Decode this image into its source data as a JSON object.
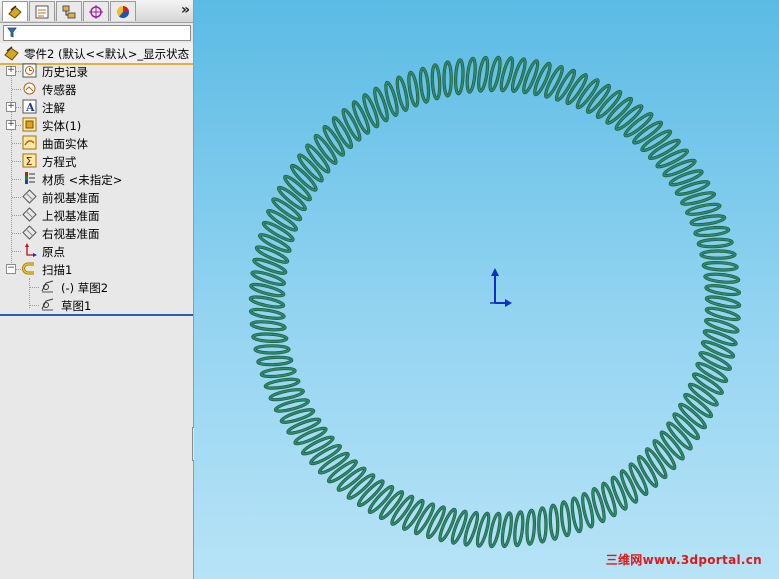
{
  "tabs": [
    {
      "name": "featuremanager",
      "icon": "feature-tree-icon"
    },
    {
      "name": "propertymanager",
      "icon": "property-manager-icon"
    },
    {
      "name": "configurationmanager",
      "icon": "configuration-icon"
    },
    {
      "name": "dimxpert",
      "icon": "dimxpert-icon"
    },
    {
      "name": "display",
      "icon": "display-manager-icon"
    }
  ],
  "more_label": "»",
  "root": {
    "label": "零件2 (默认<<默认>_显示状态"
  },
  "tree": [
    {
      "label": "历史记录",
      "icon": "history-icon",
      "expandable": true
    },
    {
      "label": "传感器",
      "icon": "sensor-icon",
      "expandable": false
    },
    {
      "label": "注解",
      "icon": "annotation-icon",
      "expandable": true
    },
    {
      "label": "实体(1)",
      "icon": "solid-body-icon",
      "expandable": true
    },
    {
      "label": "曲面实体",
      "icon": "surface-body-icon",
      "expandable": false
    },
    {
      "label": "方程式",
      "icon": "equation-icon",
      "expandable": false
    },
    {
      "label": "材质 <未指定>",
      "icon": "material-icon",
      "expandable": false
    },
    {
      "label": "前视基准面",
      "icon": "plane-icon",
      "expandable": false
    },
    {
      "label": "上视基准面",
      "icon": "plane-icon",
      "expandable": false
    },
    {
      "label": "右视基准面",
      "icon": "plane-icon",
      "expandable": false
    },
    {
      "label": "原点",
      "icon": "origin-icon",
      "expandable": false
    },
    {
      "label": "扫描1",
      "icon": "sweep-icon",
      "expandable": true,
      "expanded": true
    }
  ],
  "children": [
    {
      "label": "(-) 草图2",
      "icon": "sketch-icon"
    },
    {
      "label": "草图1",
      "icon": "sketch-icon"
    }
  ],
  "spring": {
    "coils": 120,
    "color": "#2e8b6a"
  },
  "watermark": "三维网www.3dportal.cn"
}
